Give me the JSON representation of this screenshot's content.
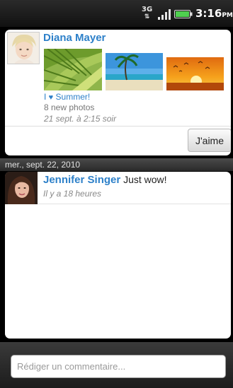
{
  "status_bar": {
    "network": "3G",
    "time": "3:16",
    "ampm": "PM",
    "icons": [
      "network-3g-icon",
      "signal-icon",
      "battery-icon"
    ],
    "battery_color": "#4fd04f"
  },
  "post": {
    "author": "Diana Mayer",
    "photos": [
      "palm-leaves-photo",
      "beach-photo",
      "sunset-photo"
    ],
    "album_title": "Summer!",
    "album_icon": "heart-icon",
    "album_count": "8 new photos",
    "date": "21 sept. à 2:15 soir",
    "like_label": "J'aime"
  },
  "date_separator": "mer., sept. 22, 2010",
  "comments": [
    {
      "author": "Jennifer Singer",
      "text": "Just wow!",
      "time": "Il y a 18 heures"
    }
  ],
  "compose": {
    "placeholder": "Rédiger un commentaire..."
  },
  "colors": {
    "accent": "#2d80c9",
    "background": "#000000"
  }
}
